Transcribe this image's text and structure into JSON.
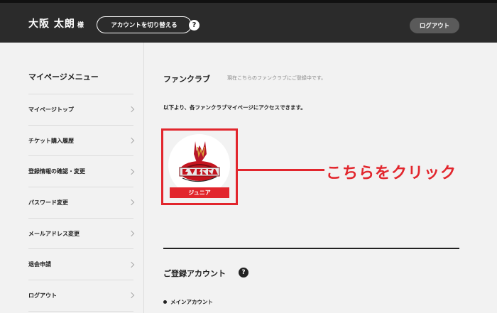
{
  "header": {
    "user_name": "大阪 太朗",
    "user_suffix": "様",
    "switch_account_label": "アカウントを切り替える",
    "help_icon": "?",
    "logout_label": "ログアウト"
  },
  "sidebar": {
    "title": "マイページメニュー",
    "items": [
      {
        "label": "マイページトップ"
      },
      {
        "label": "チケット購入履歴"
      },
      {
        "label": "登録情報の確認・変更"
      },
      {
        "label": "パスワード変更"
      },
      {
        "label": "メールアドレス変更"
      },
      {
        "label": "退会申請"
      },
      {
        "label": "ログアウト"
      }
    ]
  },
  "main": {
    "section_title": "ファンクラブ",
    "section_sub": "現在こちらのファンクラブにご登録中です。",
    "intro": "以下より、各ファンクラブマイページにアクセスできます。",
    "club": {
      "badge": "ジュニア",
      "logo_icon": "evessa-logo"
    },
    "annotation": "こちらをクリック",
    "account_title": "ご登録アカウント",
    "account_help_icon": "?",
    "main_account": "メインアカウント"
  },
  "colors": {
    "header_bg": "#2b2b2b",
    "accent_red": "#e2262d",
    "page_bg": "#f2f2f2"
  }
}
